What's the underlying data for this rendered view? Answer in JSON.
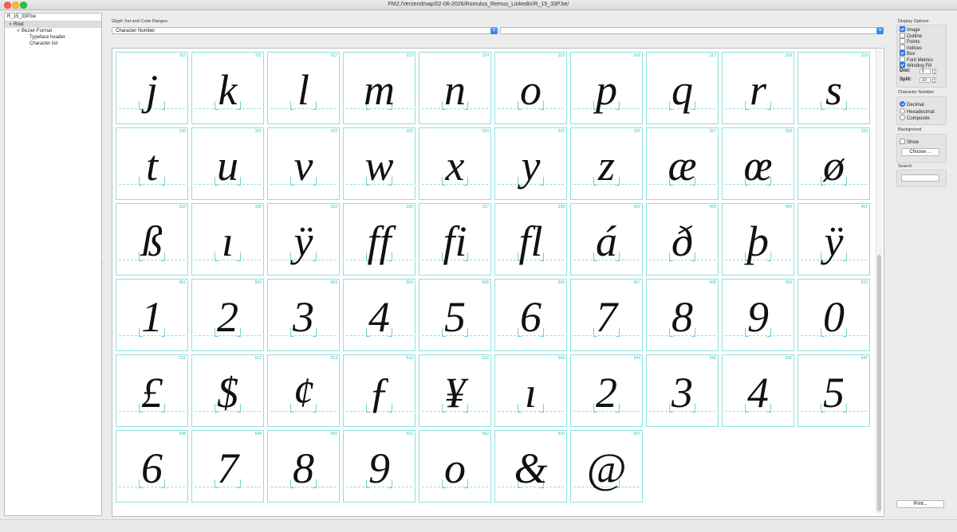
{
  "window": {
    "title": "FM2:/Verzendmap/02-06-2026/Romulus_Remus_LinkedIn/R_15_33P.be/"
  },
  "tree": {
    "header": "R_15_33P.be",
    "items": [
      {
        "label": "Root",
        "level": 0,
        "expanded": true,
        "selected": true
      },
      {
        "label": "Bezier-Format",
        "level": 1,
        "expanded": true,
        "selected": false
      },
      {
        "label": "Typeface header",
        "level": 2,
        "expanded": false,
        "selected": false
      },
      {
        "label": "Character list",
        "level": 2,
        "expanded": false,
        "selected": false
      }
    ]
  },
  "glyph_set": {
    "section_label": "Glyph Set and Code Ranges",
    "selected_value": "Character Number",
    "second_select_value": ""
  },
  "glyphs": [
    {
      "num": "310",
      "ch": "j"
    },
    {
      "num": "311",
      "ch": "k"
    },
    {
      "num": "312",
      "ch": "l"
    },
    {
      "num": "313",
      "ch": "m"
    },
    {
      "num": "314",
      "ch": "n"
    },
    {
      "num": "315",
      "ch": "o"
    },
    {
      "num": "316",
      "ch": "p"
    },
    {
      "num": "317",
      "ch": "q"
    },
    {
      "num": "318",
      "ch": "r"
    },
    {
      "num": "319",
      "ch": "s"
    },
    {
      "num": "320",
      "ch": "t"
    },
    {
      "num": "321",
      "ch": "u"
    },
    {
      "num": "322",
      "ch": "v"
    },
    {
      "num": "323",
      "ch": "w"
    },
    {
      "num": "324",
      "ch": "x"
    },
    {
      "num": "325",
      "ch": "y"
    },
    {
      "num": "326",
      "ch": "z"
    },
    {
      "num": "327",
      "ch": "æ"
    },
    {
      "num": "328",
      "ch": "œ"
    },
    {
      "num": "329",
      "ch": "ø"
    },
    {
      "num": "333",
      "ch": "ß"
    },
    {
      "num": "335",
      "ch": "ı"
    },
    {
      "num": "333",
      "ch": "ÿ"
    },
    {
      "num": "336",
      "ch": "ff"
    },
    {
      "num": "337",
      "ch": "fi"
    },
    {
      "num": "338",
      "ch": "fl"
    },
    {
      "num": "402",
      "ch": "á"
    },
    {
      "num": "459",
      "ch": "ð"
    },
    {
      "num": "460",
      "ch": "þ"
    },
    {
      "num": "461",
      "ch": "ÿ"
    },
    {
      "num": "501",
      "ch": "1"
    },
    {
      "num": "502",
      "ch": "2"
    },
    {
      "num": "503",
      "ch": "3"
    },
    {
      "num": "504",
      "ch": "4"
    },
    {
      "num": "505",
      "ch": "5"
    },
    {
      "num": "506",
      "ch": "6"
    },
    {
      "num": "507",
      "ch": "7"
    },
    {
      "num": "508",
      "ch": "8"
    },
    {
      "num": "509",
      "ch": "9"
    },
    {
      "num": "510",
      "ch": "0"
    },
    {
      "num": "511",
      "ch": "£"
    },
    {
      "num": "512",
      "ch": "$"
    },
    {
      "num": "513",
      "ch": "¢"
    },
    {
      "num": "514",
      "ch": "ƒ"
    },
    {
      "num": "516",
      "ch": "¥"
    },
    {
      "num": "543",
      "ch": "ı"
    },
    {
      "num": "544",
      "ch": "2"
    },
    {
      "num": "545",
      "ch": "3"
    },
    {
      "num": "546",
      "ch": "4"
    },
    {
      "num": "547",
      "ch": "5"
    },
    {
      "num": "548",
      "ch": "6"
    },
    {
      "num": "549",
      "ch": "7"
    },
    {
      "num": "550",
      "ch": "8"
    },
    {
      "num": "551",
      "ch": "9"
    },
    {
      "num": "552",
      "ch": "o"
    },
    {
      "num": "630",
      "ch": "&"
    },
    {
      "num": "637",
      "ch": "@"
    }
  ],
  "display_options": {
    "label": "Display Options",
    "checkboxes": [
      {
        "label": "Image",
        "checked": true
      },
      {
        "label": "Outline",
        "checked": false
      },
      {
        "label": "Points",
        "checked": false
      },
      {
        "label": "Indices",
        "checked": false
      },
      {
        "label": "Box",
        "checked": true
      },
      {
        "label": "Font Metrics",
        "checked": false
      },
      {
        "label": "Winding Fill",
        "checked": true
      }
    ],
    "dist_label": "Dist:",
    "dist_value": "5",
    "split_label": "Split:",
    "split_value": "10"
  },
  "character_number": {
    "label": "Character Number",
    "options": [
      {
        "label": "Decimal",
        "checked": true
      },
      {
        "label": "Hexadecimal",
        "checked": false
      },
      {
        "label": "Composite",
        "checked": false
      }
    ]
  },
  "background": {
    "label": "Background",
    "show_label": "Show",
    "show_checked": false,
    "choose_label": "Choose ..."
  },
  "search": {
    "label": "Search",
    "value": ""
  },
  "print": {
    "label": "Print..."
  },
  "colors": {
    "accent": "#2f7fe8",
    "cell_border": "#8fe0e0",
    "cell_number": "#2cc4c4"
  }
}
